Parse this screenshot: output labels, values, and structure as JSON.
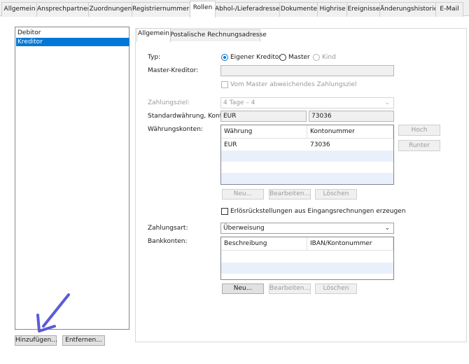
{
  "top_tabs": [
    {
      "label": "Allgemein"
    },
    {
      "label": "Ansprechpartner"
    },
    {
      "label": "Zuordnungen"
    },
    {
      "label": "Registriernummern"
    },
    {
      "label": "Rollen",
      "active": true
    },
    {
      "label": "Abhol-/Lieferadressen"
    },
    {
      "label": "Dokumente"
    },
    {
      "label": "Highrise"
    },
    {
      "label": "Ereignisse"
    },
    {
      "label": "Änderungshistorie"
    },
    {
      "label": "E-Mail"
    }
  ],
  "roles": {
    "items": [
      {
        "label": "Debitor",
        "selected": false
      },
      {
        "label": "Kreditor",
        "selected": true
      }
    ],
    "add_button": "Hinzufügen...",
    "remove_button": "Entfernen..."
  },
  "inner_tabs": [
    {
      "label": "Allgemein",
      "active": true
    },
    {
      "label": "Postalische Rechnungsadresse"
    }
  ],
  "form": {
    "typ_label": "Typ:",
    "typ_options": [
      {
        "label": "Eigener Kreditor",
        "checked": true,
        "disabled": false
      },
      {
        "label": "Master",
        "checked": false,
        "disabled": false
      },
      {
        "label": "Kind",
        "checked": false,
        "disabled": true
      }
    ],
    "master_label": "Master-Kreditor:",
    "master_value": "",
    "abweichend_label": "Vom Master abweichendes Zahlungsziel",
    "zahlungsziel_label": "Zahlungsziel:",
    "zahlungsziel_value": "4 Tage – 4",
    "standard_label": "Standardwährung, Konto:",
    "standard_currency": "EUR",
    "standard_account": "73036",
    "waehrungskonten_label": "Währungskonten:",
    "waehrung_grid": {
      "headers": [
        "Währung",
        "Kontonummer"
      ],
      "rows": [
        [
          "EUR",
          "73036"
        ]
      ]
    },
    "hoch_button": "Hoch",
    "runter_button": "Runter",
    "neu_button_1": "Neu...",
    "bearbeiten_button_1": "Bearbeiten...",
    "loeschen_button_1": "Löschen",
    "erloes_label": "Erlösrückstellungen aus Eingangsrechnungen erzeugen",
    "zahlungsart_label": "Zahlungsart:",
    "zahlungsart_value": "Überweisung",
    "bankkonten_label": "Bankkonten:",
    "bank_grid": {
      "headers": [
        "Beschreibung",
        "IBAN/Kontonummer"
      ],
      "rows": []
    },
    "neu_button_2": "Neu...",
    "bearbeiten_button_2": "Bearbeiten...",
    "loeschen_button_2": "Löschen"
  },
  "colors": {
    "selection": "#0078d7",
    "annotation_arrow": "#5b5bd6"
  }
}
